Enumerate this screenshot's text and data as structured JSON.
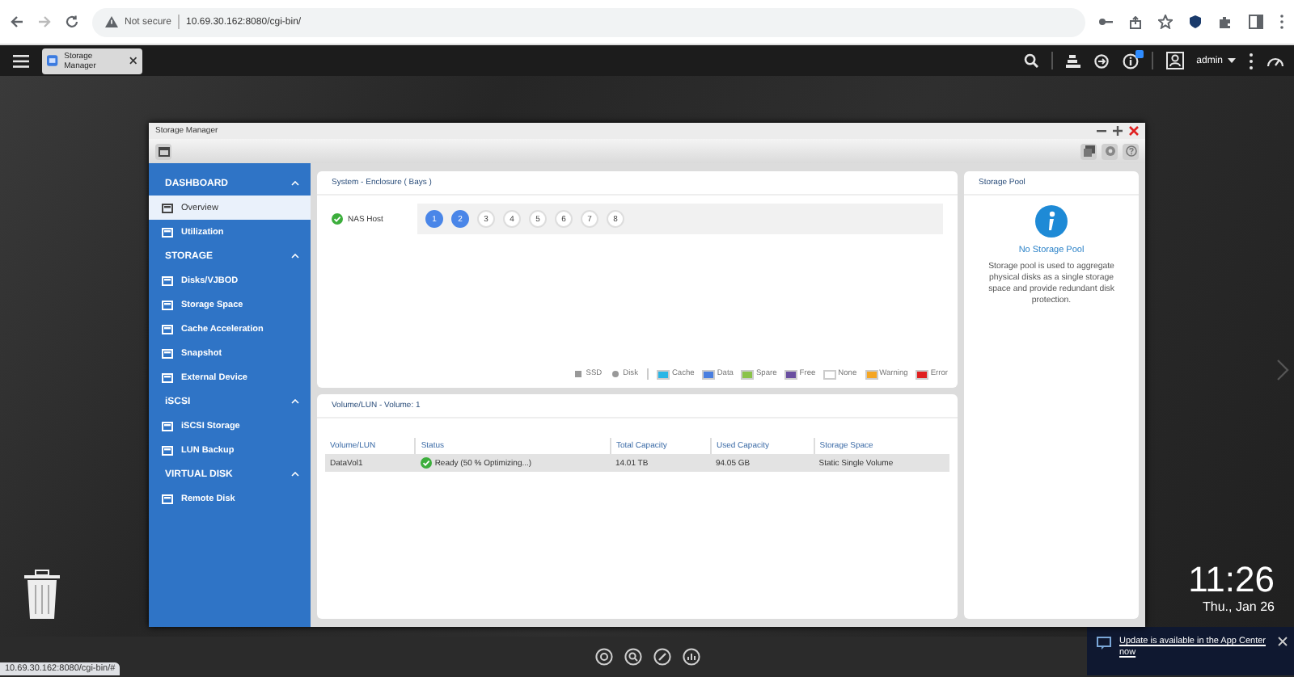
{
  "browser": {
    "security": "Not secure",
    "url": "10.69.30.162:8080/cgi-bin/"
  },
  "topbar": {
    "app_tab": "Storage Manager",
    "user": "admin",
    "notifications": true
  },
  "window": {
    "title": "Storage Manager",
    "sidebar": {
      "sections": [
        {
          "title": "DASHBOARD",
          "expanded": true,
          "items": [
            {
              "label": "Overview",
              "selected": true
            },
            {
              "label": "Utilization",
              "selected": false
            }
          ]
        },
        {
          "title": "STORAGE",
          "expanded": true,
          "items": [
            {
              "label": "Disks/VJBOD",
              "selected": false
            },
            {
              "label": "Storage Space",
              "selected": false
            },
            {
              "label": "Cache Acceleration",
              "selected": false
            },
            {
              "label": "Snapshot",
              "selected": false
            },
            {
              "label": "External Device",
              "selected": false
            }
          ]
        },
        {
          "title": "iSCSI",
          "expanded": true,
          "items": [
            {
              "label": "iSCSI Storage",
              "selected": false
            },
            {
              "label": "LUN Backup",
              "selected": false
            }
          ]
        },
        {
          "title": "VIRTUAL DISK",
          "expanded": true,
          "items": [
            {
              "label": "Remote Disk",
              "selected": false
            }
          ]
        }
      ]
    },
    "system": {
      "title": "System - Enclosure ( Bays )",
      "host": "NAS Host",
      "bays": [
        {
          "label": "1",
          "occupied": true
        },
        {
          "label": "2",
          "occupied": true
        },
        {
          "label": "3",
          "occupied": false
        },
        {
          "label": "4",
          "occupied": false
        },
        {
          "label": "5",
          "occupied": false
        },
        {
          "label": "6",
          "occupied": false
        },
        {
          "label": "7",
          "occupied": false
        },
        {
          "label": "8",
          "occupied": false
        }
      ],
      "legend": [
        {
          "kind": "ssd",
          "label": "SSD"
        },
        {
          "kind": "disk",
          "label": "Disk"
        },
        {
          "kind": "swatch",
          "label": "Cache",
          "color": "#29b6e6"
        },
        {
          "kind": "swatch",
          "label": "Data",
          "color": "#4a7fe0"
        },
        {
          "kind": "swatch",
          "label": "Spare",
          "color": "#8bc34a"
        },
        {
          "kind": "swatch",
          "label": "Free",
          "color": "#6a4fa0"
        },
        {
          "kind": "swatch",
          "label": "None",
          "color": "#ffffff"
        },
        {
          "kind": "swatch",
          "label": "Warning",
          "color": "#f5a623"
        },
        {
          "kind": "swatch",
          "label": "Error",
          "color": "#e02020"
        }
      ]
    },
    "volumes": {
      "title": "Volume/LUN - Volume: 1",
      "columns": [
        "Volume/LUN",
        "Status",
        "Total Capacity",
        "Used Capacity",
        "Storage Space"
      ],
      "rows": [
        {
          "selected": true,
          "cells": [
            "DataVol1",
            "Ready (50 % Optimizing...)",
            "14.01 TB",
            "94.05 GB",
            "Static Single Volume"
          ]
        }
      ]
    },
    "storage_pool": {
      "title": "Storage Pool",
      "heading": "No Storage Pool",
      "text": "Storage pool is used to aggregate physical disks as a single storage space and provide redundant disk protection."
    }
  },
  "clock": {
    "time": "11:26",
    "date": "Thu., Jan 26"
  },
  "notification": {
    "text": "Update is available in the App Center now"
  },
  "status_url": "10.69.30.162:8080/cgi-bin/#"
}
